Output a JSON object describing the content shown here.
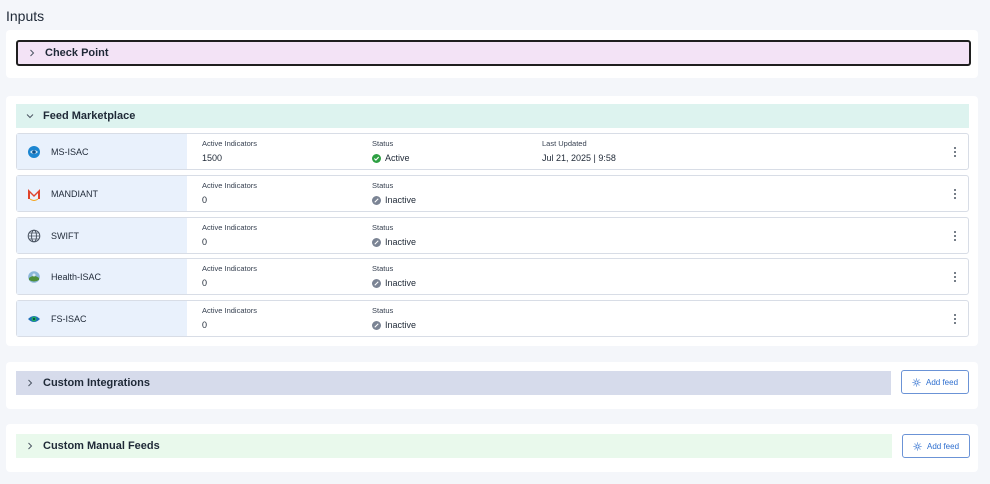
{
  "page": {
    "title": "Inputs"
  },
  "sections": {
    "checkpoint": {
      "title": "Check Point",
      "expanded": false,
      "color": "#f3e3f6",
      "border": "#1f1f1f"
    },
    "feed_marketplace": {
      "title": "Feed Marketplace",
      "expanded": true,
      "color": "#ddf3ef"
    },
    "custom_integrations": {
      "title": "Custom Integrations",
      "expanded": false,
      "color": "#d6dbeb",
      "add_label": "Add feed"
    },
    "custom_manual_feeds": {
      "title": "Custom Manual Feeds",
      "expanded": false,
      "color": "#e9f9ec",
      "add_label": "Add feed"
    }
  },
  "feed_columns": {
    "active_indicators": "Active Indicators",
    "status": "Status",
    "last_updated": "Last Updated"
  },
  "feeds": [
    {
      "name": "MS-ISAC",
      "logo": "ms-isac-logo",
      "active_indicators": "1500",
      "status": "Active",
      "last_updated": "Jul 21, 2025 | 9:58"
    },
    {
      "name": "MANDIANT",
      "logo": "mandiant-logo",
      "active_indicators": "0",
      "status": "Inactive"
    },
    {
      "name": "SWIFT",
      "logo": "globe-icon",
      "active_indicators": "0",
      "status": "Inactive"
    },
    {
      "name": "Health-ISAC",
      "logo": "health-isac-logo",
      "active_indicators": "0",
      "status": "Inactive"
    },
    {
      "name": "FS-ISAC",
      "logo": "fs-isac-logo",
      "active_indicators": "0",
      "status": "Inactive"
    }
  ],
  "colors": {
    "active": "#2ea043",
    "inactive": "#7b8494",
    "accent": "#2f6fcf"
  }
}
